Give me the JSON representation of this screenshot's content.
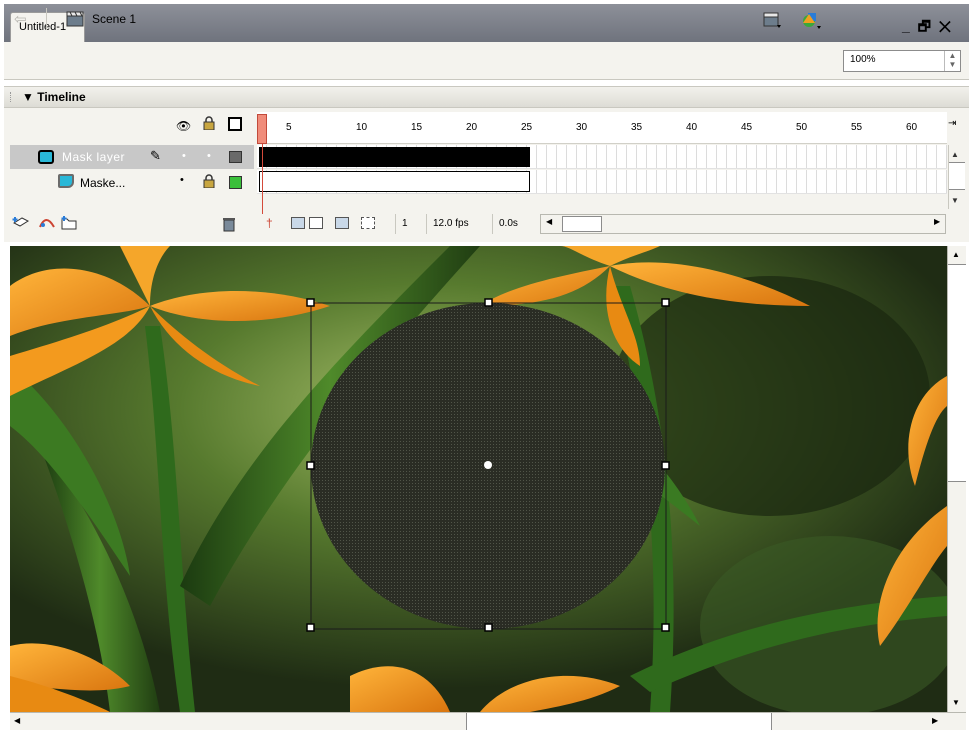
{
  "window": {
    "tab_title": "Untitled-1*",
    "controls": "_ ̅❐ ✕"
  },
  "editbar": {
    "scene_label": "Scene 1",
    "zoom_value": "100%"
  },
  "timeline": {
    "title": "Timeline",
    "ruler_ticks": [
      "5",
      "10",
      "15",
      "20",
      "25",
      "30",
      "35",
      "40",
      "45",
      "50",
      "55",
      "60"
    ],
    "layers": [
      {
        "name": "Mask layer",
        "selected": true,
        "outline_color": "#6a6a6a"
      },
      {
        "name": "Maske...",
        "selected": false,
        "outline_color": "#3ac03a"
      }
    ],
    "current_frame": "1",
    "frame_rate": "12.0 fps",
    "elapsed": "0.0s"
  },
  "colors": {
    "tab_bar": "#7d818a",
    "panel": "#f4f3ee",
    "selected_row": "#c8c8c8",
    "playhead": "#f08c7a",
    "flower": "#f39a1e",
    "mask_circle": "#26281f"
  },
  "icons": {
    "back": "back-arrow-icon",
    "scene": "scene-clapper-icon",
    "edit_symbols": "edit-symbols-icon",
    "edit_scene": "edit-scene-icon",
    "eye": "eye-icon",
    "lock": "lock-icon",
    "outline": "outline-icon",
    "pencil": "pencil-icon",
    "trash": "trash-icon"
  }
}
